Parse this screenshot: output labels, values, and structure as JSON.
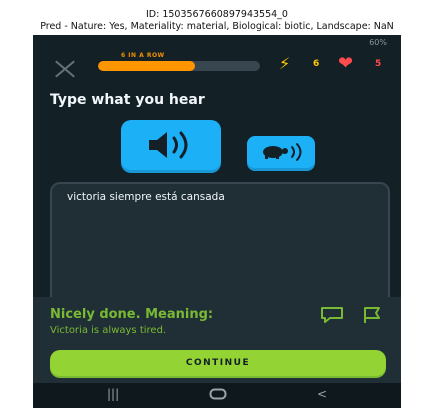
{
  "caption": {
    "line1": "ID: 1503567660897943554_0",
    "line2": "Pred - Nature: Yes, Materiality: material, Biological: biotic, Landscape: NaN"
  },
  "status": {
    "battery": "60%"
  },
  "header": {
    "streak_label": "6 IN A ROW",
    "progress_fraction": 0.6,
    "gems_count": "6",
    "hearts_count": "5"
  },
  "lesson": {
    "title": "Type what you hear",
    "answer": "victoria siempre está cansada"
  },
  "feedback": {
    "title": "Nicely done. Meaning:",
    "meaning": "Victoria is always tired.",
    "continue_label": "CONTINUE"
  },
  "colors": {
    "background": "#132026",
    "accent_blue": "#1cb0f6",
    "success_green": "#93d333",
    "streak_orange": "#ff9600",
    "heart_red": "#ff4b4b",
    "gem_yellow": "#ffc800"
  },
  "icons": [
    "close-icon",
    "lightning-icon",
    "heart-icon",
    "speaker-icon",
    "turtle-speaker-icon",
    "comment-icon",
    "flag-icon"
  ]
}
